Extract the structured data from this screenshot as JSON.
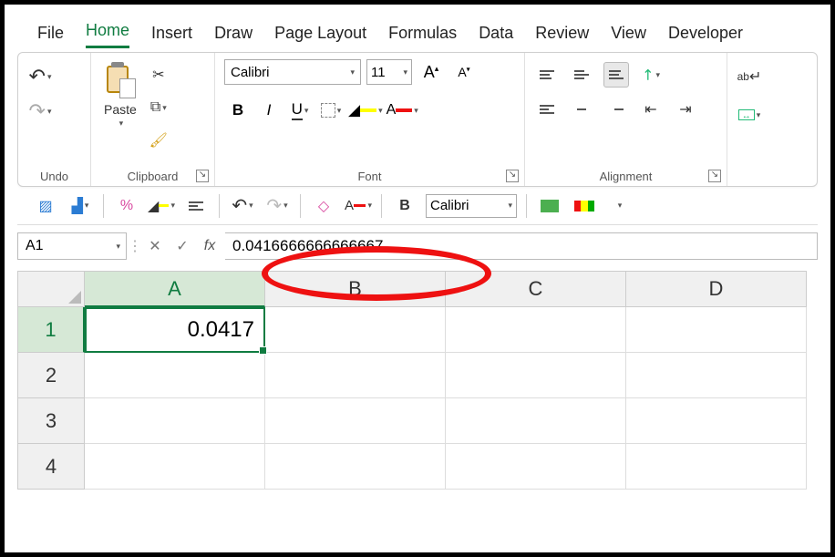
{
  "tabs": [
    "File",
    "Home",
    "Insert",
    "Draw",
    "Page Layout",
    "Formulas",
    "Data",
    "Review",
    "View",
    "Developer"
  ],
  "active_tab": 1,
  "ribbon": {
    "undo_label": "Undo",
    "clipboard_label": "Clipboard",
    "paste_label": "Paste",
    "font_label": "Font",
    "alignment_label": "Alignment",
    "font_name": "Calibri",
    "font_size": "11",
    "bold": "B",
    "italic": "I",
    "underline": "U",
    "wrap": "ab"
  },
  "qat": {
    "combo_font": "Calibri",
    "bold": "B"
  },
  "name_box": "A1",
  "formula_value": "0.0416666666666667",
  "columns": [
    "A",
    "B",
    "C",
    "D"
  ],
  "rows": [
    "1",
    "2",
    "3",
    "4"
  ],
  "selected_cell": {
    "row": 0,
    "col": 0
  },
  "cell_A1": "0.0417"
}
